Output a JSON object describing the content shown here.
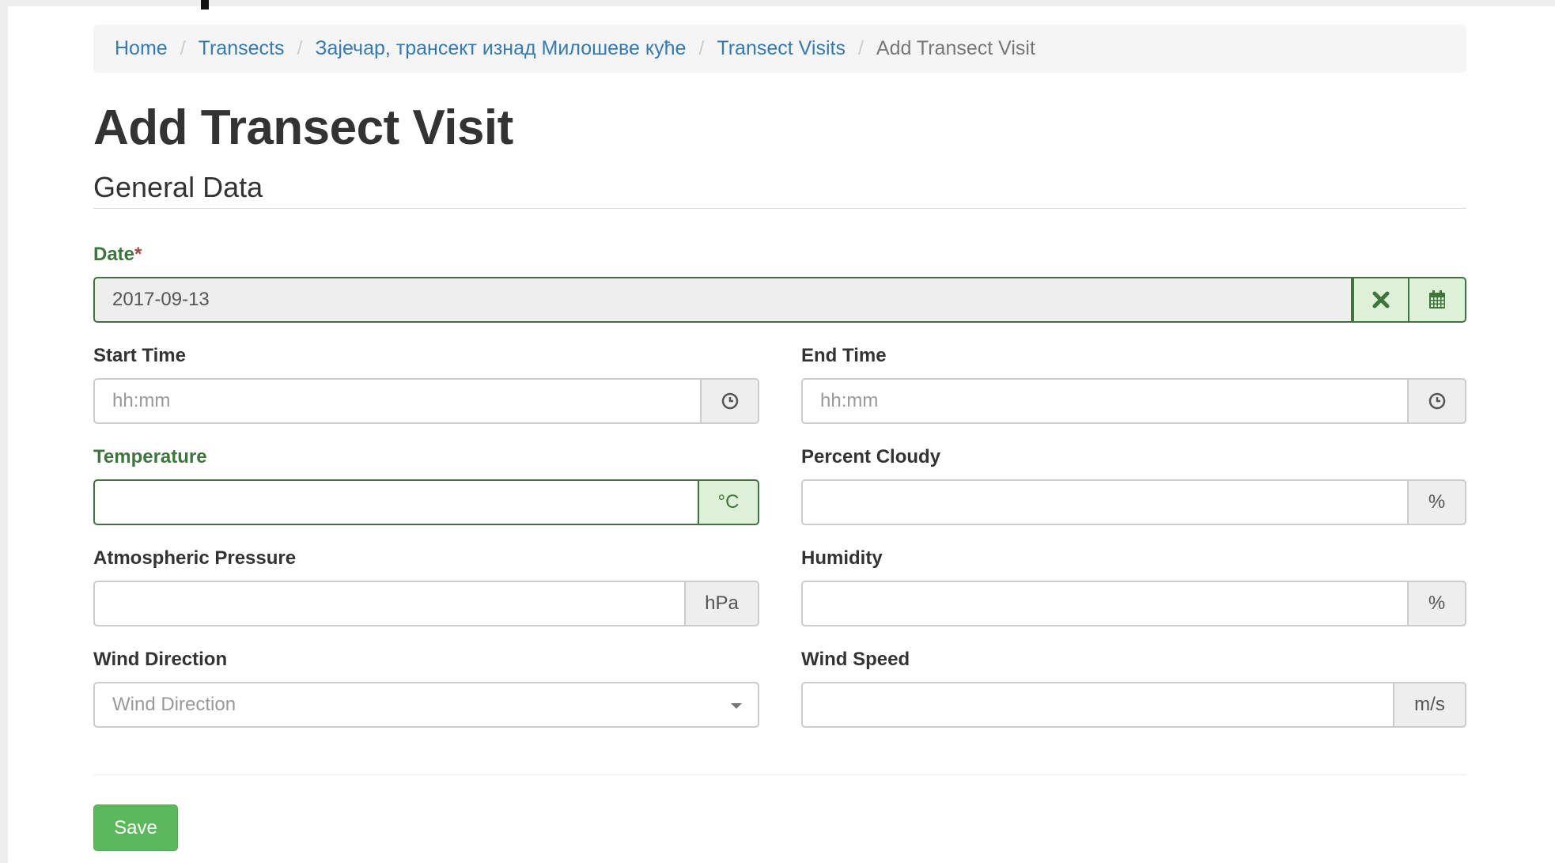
{
  "breadcrumb": {
    "items": [
      {
        "label": "Home"
      },
      {
        "label": "Transects"
      },
      {
        "label": "Зајечар, трансект изнад Милошеве куће"
      },
      {
        "label": "Transect Visits"
      }
    ],
    "separator": "/",
    "active": "Add Transect Visit"
  },
  "page_title": "Add Transect Visit",
  "section_title": "General Data",
  "form": {
    "date": {
      "label": "Date",
      "required_mark": "*",
      "value": "2017-09-13",
      "clear_icon": "times-icon",
      "calendar_icon": "calendar-icon"
    },
    "start_time": {
      "label": "Start Time",
      "placeholder": "hh:mm",
      "icon": "clock-icon"
    },
    "end_time": {
      "label": "End Time",
      "placeholder": "hh:mm",
      "icon": "clock-icon"
    },
    "temperature": {
      "label": "Temperature",
      "value": "",
      "unit": "°C"
    },
    "percent_cloudy": {
      "label": "Percent Cloudy",
      "value": "",
      "unit": "%"
    },
    "atmospheric_pressure": {
      "label": "Atmospheric Pressure",
      "value": "",
      "unit": "hPa"
    },
    "humidity": {
      "label": "Humidity",
      "value": "",
      "unit": "%"
    },
    "wind_direction": {
      "label": "Wind Direction",
      "placeholder": "Wind Direction"
    },
    "wind_speed": {
      "label": "Wind Speed",
      "value": "",
      "unit": "m/s"
    }
  },
  "actions": {
    "save_label": "Save"
  },
  "colors": {
    "link": "#337ab7",
    "success": "#3c763d",
    "success_bg": "#dff0d8",
    "button": "#5cb85c",
    "required": "#a94442"
  }
}
